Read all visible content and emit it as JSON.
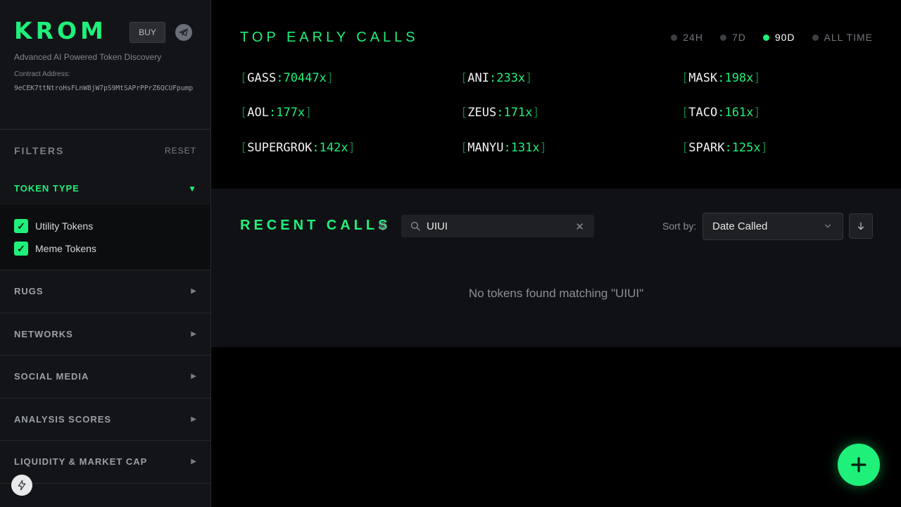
{
  "brand": {
    "logo": "KROM",
    "buy_label": "BUY",
    "tagline": "Advanced AI Powered Token Discovery",
    "contract_label": "Contract Address:",
    "contract_address": "9eCEK7ttNtroHsFLnW8jW7pS9MtSAPrPPrZ6QCUFpump"
  },
  "filters": {
    "title": "FILTERS",
    "reset_label": "RESET",
    "token_type": {
      "label": "TOKEN TYPE",
      "caret": "▼",
      "options": [
        {
          "label": "Utility Tokens",
          "checked": true
        },
        {
          "label": "Meme Tokens",
          "checked": true
        }
      ]
    },
    "sections": [
      {
        "label": "RUGS",
        "caret": "▶"
      },
      {
        "label": "NETWORKS",
        "caret": "▶"
      },
      {
        "label": "SOCIAL MEDIA",
        "caret": "▶"
      },
      {
        "label": "ANALYSIS SCORES",
        "caret": "▶"
      },
      {
        "label": "LIQUIDITY & MARKET CAP",
        "caret": "▶"
      }
    ]
  },
  "top_calls": {
    "title": "TOP EARLY CALLS",
    "periods": [
      {
        "label": "24H",
        "active": false
      },
      {
        "label": "7D",
        "active": false
      },
      {
        "label": "90D",
        "active": true
      },
      {
        "label": "ALL TIME",
        "active": false
      }
    ],
    "items": [
      {
        "name": "GASS",
        "mult": "70447x"
      },
      {
        "name": "ANI",
        "mult": "233x"
      },
      {
        "name": "MASK",
        "mult": "198x"
      },
      {
        "name": "AOL",
        "mult": "177x"
      },
      {
        "name": "ZEUS",
        "mult": "171x"
      },
      {
        "name": "TACO",
        "mult": "161x"
      },
      {
        "name": "SUPERGROK",
        "mult": "142x"
      },
      {
        "name": "MANYU",
        "mult": "131x"
      },
      {
        "name": "SPARK",
        "mult": "125x"
      }
    ]
  },
  "recent_calls": {
    "title": "RECENT CALLS",
    "search_value": "UIUI",
    "clear_glyph": "✕",
    "sort_label": "Sort by:",
    "sort_value": "Date Called",
    "empty_message": "No tokens found matching \"UIUI\""
  },
  "colors": {
    "accent": "#1ff07a",
    "sidebar_bg": "#131417",
    "panel_bg": "#101114"
  },
  "icons": {
    "telegram": "telegram-icon",
    "gear": "gear-icon",
    "search": "search-icon",
    "chevron": "chevron-down-icon",
    "sort_direction": "arrow-down-icon",
    "fab": "plus-icon",
    "bolt": "lightning-icon"
  }
}
